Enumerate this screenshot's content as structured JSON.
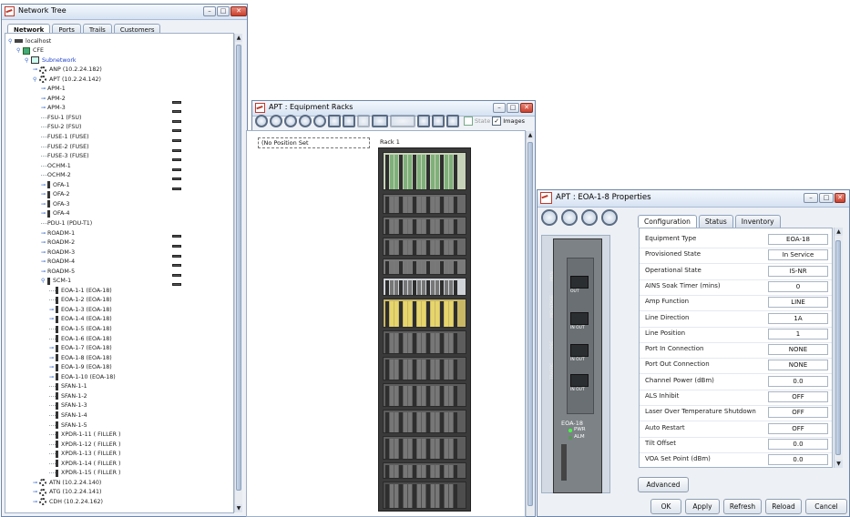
{
  "network_tree": {
    "title": "Network Tree",
    "tabs": [
      "Network",
      "Ports",
      "Trails",
      "Customers"
    ],
    "nodes": [
      {
        "label": "localhost",
        "level": 0,
        "icon": "host",
        "tog": "minus"
      },
      {
        "label": "CFE",
        "level": 1,
        "icon": "cfe",
        "tog": "minus"
      },
      {
        "label": "Subnetwork",
        "level": 2,
        "icon": "sub",
        "tog": "minus",
        "blue": true
      },
      {
        "label": "ANP (10.2.24.182)",
        "level": 3,
        "icon": "gear",
        "tog": "plus"
      },
      {
        "label": "APT (10.2.24.142)",
        "level": 3,
        "icon": "gear",
        "tog": "minus"
      },
      {
        "label": "APM-1",
        "level": 4,
        "icon": "rack",
        "tog": "plus"
      },
      {
        "label": "APM-2",
        "level": 4,
        "icon": "rack",
        "tog": "plus"
      },
      {
        "label": "APM-3",
        "level": 4,
        "icon": "rack",
        "tog": "plus"
      },
      {
        "label": "FSU-1 (FSU)",
        "level": 4,
        "icon": "rack",
        "tog": ""
      },
      {
        "label": "FSU-2 (FSU)",
        "level": 4,
        "icon": "rack",
        "tog": ""
      },
      {
        "label": "FUSE-1 (FUSE)",
        "level": 4,
        "icon": "rack",
        "tog": ""
      },
      {
        "label": "FUSE-2 (FUSE)",
        "level": 4,
        "icon": "rack",
        "tog": ""
      },
      {
        "label": "FUSE-3 (FUSE)",
        "level": 4,
        "icon": "rack",
        "tog": ""
      },
      {
        "label": "OCHM-1",
        "level": 4,
        "icon": "rack",
        "tog": ""
      },
      {
        "label": "OCHM-2",
        "level": 4,
        "icon": "rack",
        "tog": ""
      },
      {
        "label": "OFA-1",
        "level": 4,
        "icon": "slot",
        "tog": "plus"
      },
      {
        "label": "OFA-2",
        "level": 4,
        "icon": "slot",
        "tog": "plus"
      },
      {
        "label": "OFA-3",
        "level": 4,
        "icon": "slot",
        "tog": "plus"
      },
      {
        "label": "OFA-4",
        "level": 4,
        "icon": "slot",
        "tog": "plus"
      },
      {
        "label": "PDU-1 (PDU-T1)",
        "level": 4,
        "icon": "rack",
        "tog": ""
      },
      {
        "label": "ROADM-1",
        "level": 4,
        "icon": "rack",
        "tog": "plus"
      },
      {
        "label": "ROADM-2",
        "level": 4,
        "icon": "rack",
        "tog": "plus"
      },
      {
        "label": "ROADM-3",
        "level": 4,
        "icon": "rack",
        "tog": "plus"
      },
      {
        "label": "ROADM-4",
        "level": 4,
        "icon": "rack",
        "tog": "plus"
      },
      {
        "label": "ROADM-5",
        "level": 4,
        "icon": "rack",
        "tog": "plus"
      },
      {
        "label": "SCM-1",
        "level": 4,
        "icon": "slot",
        "tog": "minus"
      },
      {
        "label": "EOA-1-1 (EOA-18)",
        "level": 5,
        "icon": "slot",
        "tog": ""
      },
      {
        "label": "EOA-1-2 (EOA-18)",
        "level": 5,
        "icon": "slot",
        "tog": ""
      },
      {
        "label": "EOA-1-3 (EOA-18)",
        "level": 5,
        "icon": "slot",
        "tog": "plus"
      },
      {
        "label": "EOA-1-4 (EOA-18)",
        "level": 5,
        "icon": "slot",
        "tog": "plus"
      },
      {
        "label": "EOA-1-5 (EOA-18)",
        "level": 5,
        "icon": "slot",
        "tog": ""
      },
      {
        "label": "EOA-1-6 (EOA-18)",
        "level": 5,
        "icon": "slot",
        "tog": ""
      },
      {
        "label": "EOA-1-7 (EOA-18)",
        "level": 5,
        "icon": "slot",
        "tog": "plus"
      },
      {
        "label": "EOA-1-8 (EOA-18)",
        "level": 5,
        "icon": "slot",
        "tog": "plus"
      },
      {
        "label": "EOA-1-9 (EOA-18)",
        "level": 5,
        "icon": "slot",
        "tog": "plus"
      },
      {
        "label": "EOA-1-10 (EOA-18)",
        "level": 5,
        "icon": "slot",
        "tog": "plus"
      },
      {
        "label": "SFAN-1-1",
        "level": 5,
        "icon": "slot",
        "tog": ""
      },
      {
        "label": "SFAN-1-2",
        "level": 5,
        "icon": "slot",
        "tog": ""
      },
      {
        "label": "SFAN-1-3",
        "level": 5,
        "icon": "slot",
        "tog": ""
      },
      {
        "label": "SFAN-1-4",
        "level": 5,
        "icon": "slot",
        "tog": ""
      },
      {
        "label": "SFAN-1-5",
        "level": 5,
        "icon": "slot",
        "tog": ""
      },
      {
        "label": "XPDR-1-11 ( FILLER )",
        "level": 5,
        "icon": "slot",
        "tog": ""
      },
      {
        "label": "XPDR-1-12 ( FILLER )",
        "level": 5,
        "icon": "slot",
        "tog": ""
      },
      {
        "label": "XPDR-1-13 ( FILLER )",
        "level": 5,
        "icon": "slot",
        "tog": ""
      },
      {
        "label": "XPDR-1-14 ( FILLER )",
        "level": 5,
        "icon": "slot",
        "tog": ""
      },
      {
        "label": "XPDR-1-15 ( FILLER )",
        "level": 5,
        "icon": "slot",
        "tog": ""
      },
      {
        "label": "ATN (10.2.24.140)",
        "level": 3,
        "icon": "gear",
        "tog": "plus"
      },
      {
        "label": "ATG (10.2.24.141)",
        "level": 3,
        "icon": "gear",
        "tog": "plus"
      },
      {
        "label": "CDH (10.2.24.162)",
        "level": 3,
        "icon": "gear",
        "tog": "plus"
      }
    ]
  },
  "equipment_racks": {
    "title": "APT : Equipment Racks",
    "state_label": "State",
    "images_label": "Images",
    "no_position_set": "(No Position Set",
    "rack_label": "Rack 1"
  },
  "properties": {
    "title": "APT : EOA-1-8 Properties",
    "tabs": [
      "Configuration",
      "Status",
      "Inventory"
    ],
    "rows": [
      {
        "label": "Equipment Type",
        "value": "EOA-18"
      },
      {
        "label": "Provisioned State",
        "value": "In Service"
      },
      {
        "label": "Operational State",
        "value": "IS-NR"
      },
      {
        "label": "AINS Soak Timer (mins)",
        "value": "0"
      },
      {
        "label": "Amp Function",
        "value": "LINE"
      },
      {
        "label": "Line Direction",
        "value": "1A"
      },
      {
        "label": "Line Position",
        "value": "1"
      },
      {
        "label": "Port In Connection",
        "value": "NONE"
      },
      {
        "label": "Port Out Connection",
        "value": "NONE"
      },
      {
        "label": "Channel Power (dBm)",
        "value": "0.0"
      },
      {
        "label": "ALS Inhibit",
        "value": "OFF"
      },
      {
        "label": "Laser Over Temperature Shutdown",
        "value": "OFF"
      },
      {
        "label": "Auto Restart",
        "value": "OFF"
      },
      {
        "label": "Tilt Offset",
        "value": "0.0"
      },
      {
        "label": "VOA Set Point (dBm)",
        "value": "0.0"
      }
    ],
    "advanced_label": "Advanced",
    "buttons": {
      "ok": "OK",
      "apply": "Apply",
      "refresh": "Refresh",
      "reload": "Reload",
      "cancel": "Cancel"
    },
    "card": {
      "side_labels": [
        "MON",
        "MID-STAGE",
        "OSC",
        "TRAFFIC"
      ],
      "port_labels": [
        "OUT",
        "IN OUT",
        "IN OUT",
        "IN OUT"
      ],
      "name": "EOA-18",
      "pwr": "PWR",
      "alm": "ALM"
    }
  }
}
